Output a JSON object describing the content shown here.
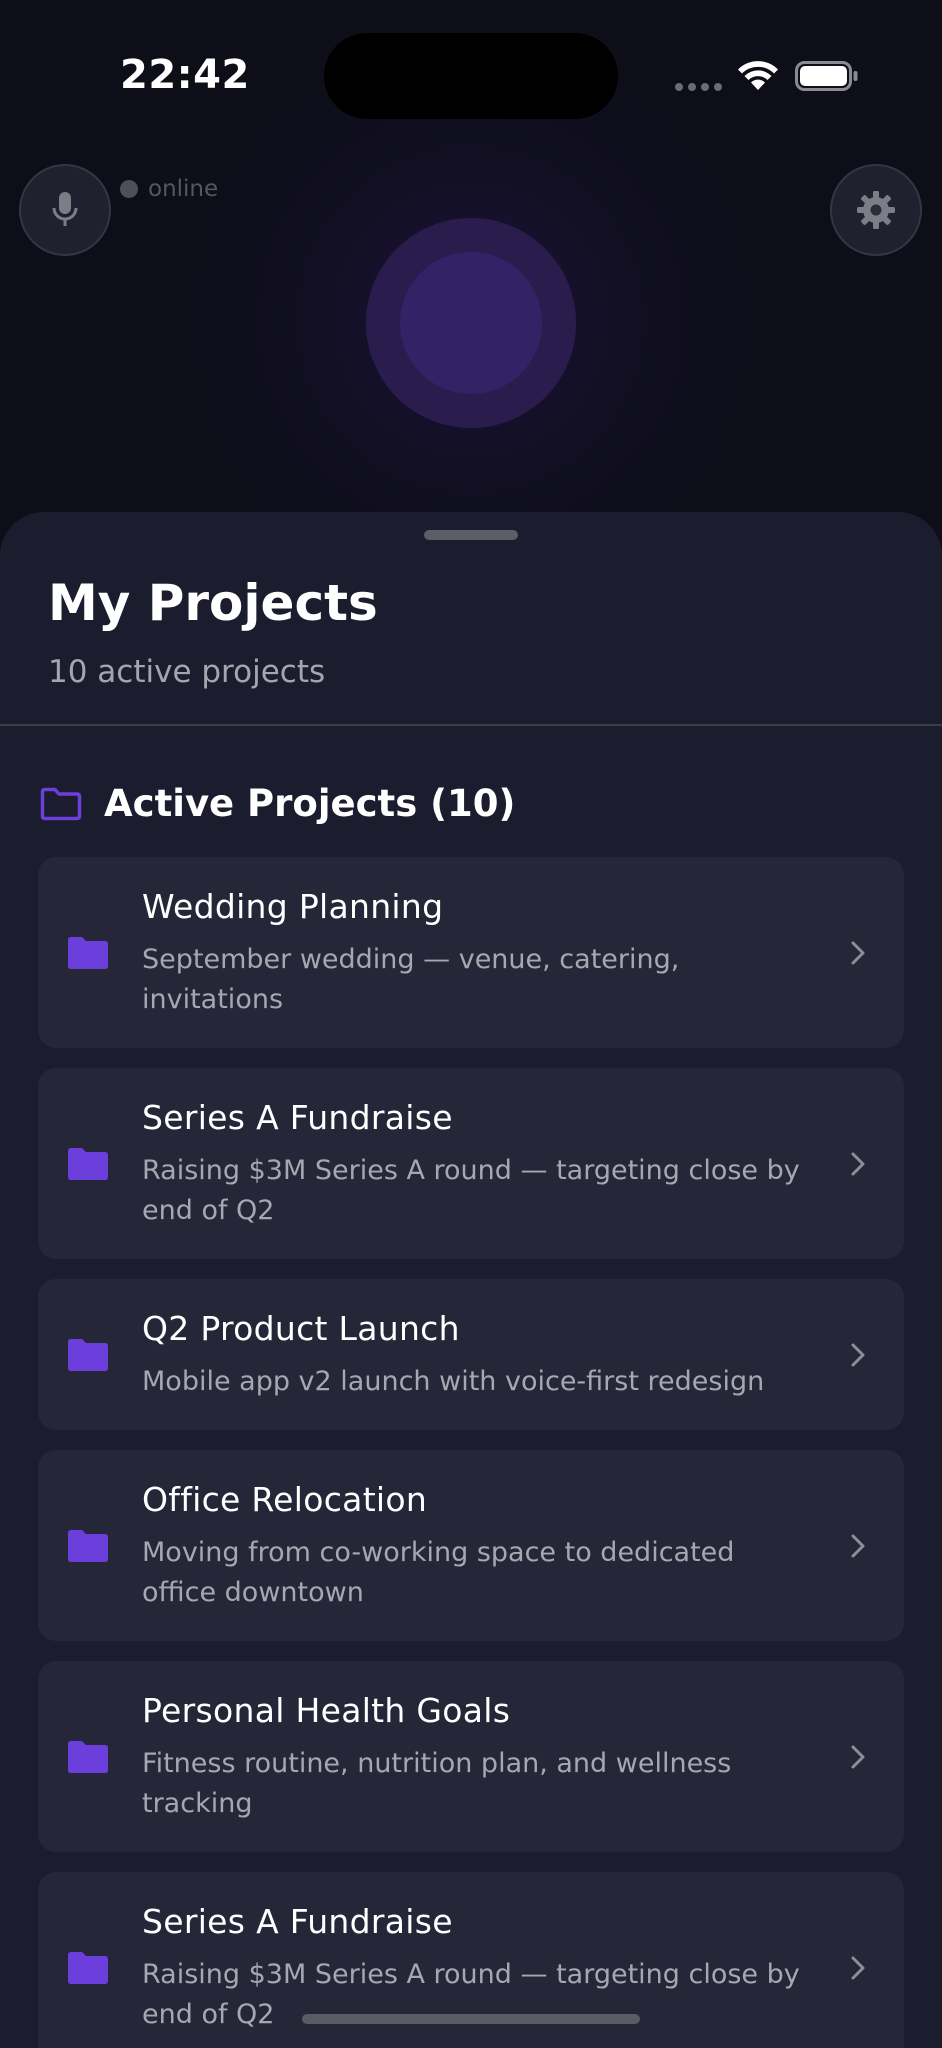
{
  "status_bar": {
    "time": "22:42"
  },
  "top": {
    "status_label": "online"
  },
  "sheet": {
    "title": "My Projects",
    "subtitle": "10 active projects",
    "section_title": "Active Projects (10)"
  },
  "projects": [
    {
      "title": "Wedding Planning",
      "description": "September wedding — venue, catering, invitations"
    },
    {
      "title": "Series A Fundraise",
      "description": "Raising $3M Series A round — targeting close by end of Q2"
    },
    {
      "title": "Q2 Product Launch",
      "description": "Mobile app v2 launch with voice-first redesign"
    },
    {
      "title": "Office Relocation",
      "description": "Moving from co-working space to dedicated office downtown"
    },
    {
      "title": "Personal Health Goals",
      "description": "Fitness routine, nutrition plan, and wellness tracking"
    },
    {
      "title": "Series A Fundraise",
      "description": "Raising $3M Series A round — targeting close by end of Q2"
    }
  ],
  "colors": {
    "accent": "#6c3fdc",
    "sheet_bg": "#1b1c2d",
    "card_bg": "#252637"
  }
}
